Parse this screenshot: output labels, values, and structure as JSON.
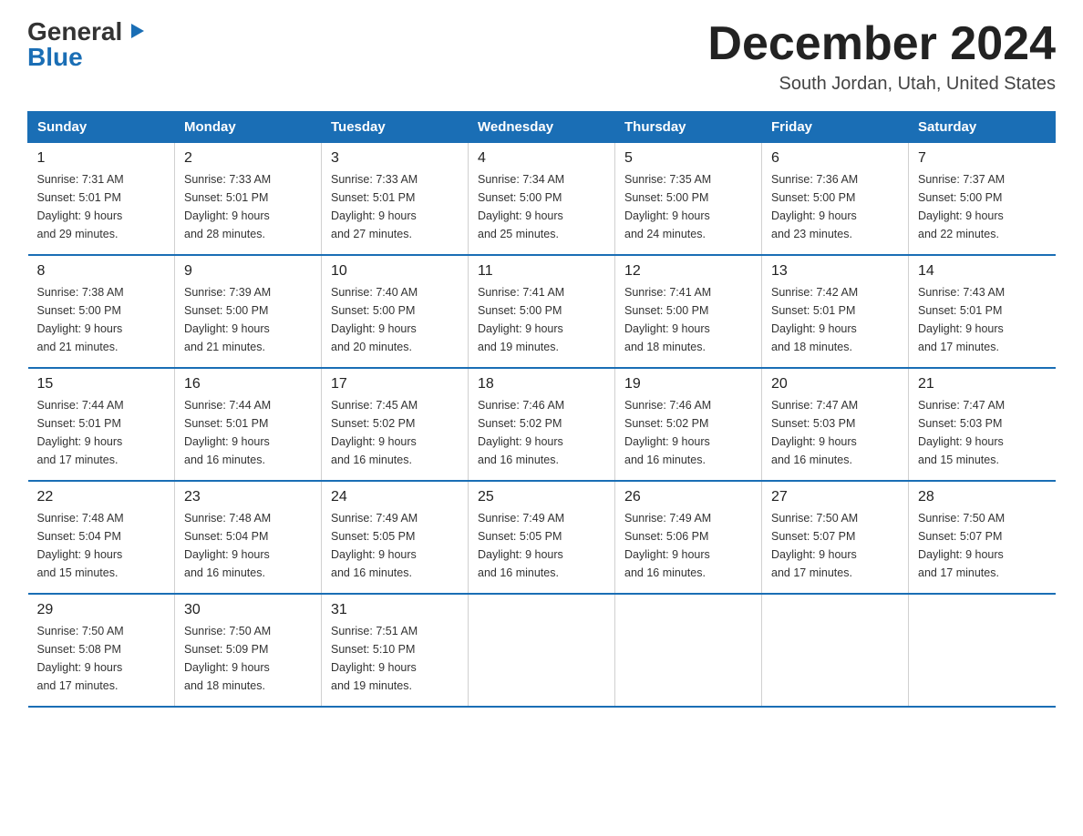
{
  "logo": {
    "general": "General",
    "blue": "Blue"
  },
  "title": "December 2024",
  "location": "South Jordan, Utah, United States",
  "days_of_week": [
    "Sunday",
    "Monday",
    "Tuesday",
    "Wednesday",
    "Thursday",
    "Friday",
    "Saturday"
  ],
  "weeks": [
    [
      {
        "day": "1",
        "sunrise": "7:31 AM",
        "sunset": "5:01 PM",
        "daylight": "9 hours and 29 minutes."
      },
      {
        "day": "2",
        "sunrise": "7:33 AM",
        "sunset": "5:01 PM",
        "daylight": "9 hours and 28 minutes."
      },
      {
        "day": "3",
        "sunrise": "7:33 AM",
        "sunset": "5:01 PM",
        "daylight": "9 hours and 27 minutes."
      },
      {
        "day": "4",
        "sunrise": "7:34 AM",
        "sunset": "5:00 PM",
        "daylight": "9 hours and 25 minutes."
      },
      {
        "day": "5",
        "sunrise": "7:35 AM",
        "sunset": "5:00 PM",
        "daylight": "9 hours and 24 minutes."
      },
      {
        "day": "6",
        "sunrise": "7:36 AM",
        "sunset": "5:00 PM",
        "daylight": "9 hours and 23 minutes."
      },
      {
        "day": "7",
        "sunrise": "7:37 AM",
        "sunset": "5:00 PM",
        "daylight": "9 hours and 22 minutes."
      }
    ],
    [
      {
        "day": "8",
        "sunrise": "7:38 AM",
        "sunset": "5:00 PM",
        "daylight": "9 hours and 21 minutes."
      },
      {
        "day": "9",
        "sunrise": "7:39 AM",
        "sunset": "5:00 PM",
        "daylight": "9 hours and 21 minutes."
      },
      {
        "day": "10",
        "sunrise": "7:40 AM",
        "sunset": "5:00 PM",
        "daylight": "9 hours and 20 minutes."
      },
      {
        "day": "11",
        "sunrise": "7:41 AM",
        "sunset": "5:00 PM",
        "daylight": "9 hours and 19 minutes."
      },
      {
        "day": "12",
        "sunrise": "7:41 AM",
        "sunset": "5:00 PM",
        "daylight": "9 hours and 18 minutes."
      },
      {
        "day": "13",
        "sunrise": "7:42 AM",
        "sunset": "5:01 PM",
        "daylight": "9 hours and 18 minutes."
      },
      {
        "day": "14",
        "sunrise": "7:43 AM",
        "sunset": "5:01 PM",
        "daylight": "9 hours and 17 minutes."
      }
    ],
    [
      {
        "day": "15",
        "sunrise": "7:44 AM",
        "sunset": "5:01 PM",
        "daylight": "9 hours and 17 minutes."
      },
      {
        "day": "16",
        "sunrise": "7:44 AM",
        "sunset": "5:01 PM",
        "daylight": "9 hours and 16 minutes."
      },
      {
        "day": "17",
        "sunrise": "7:45 AM",
        "sunset": "5:02 PM",
        "daylight": "9 hours and 16 minutes."
      },
      {
        "day": "18",
        "sunrise": "7:46 AM",
        "sunset": "5:02 PM",
        "daylight": "9 hours and 16 minutes."
      },
      {
        "day": "19",
        "sunrise": "7:46 AM",
        "sunset": "5:02 PM",
        "daylight": "9 hours and 16 minutes."
      },
      {
        "day": "20",
        "sunrise": "7:47 AM",
        "sunset": "5:03 PM",
        "daylight": "9 hours and 16 minutes."
      },
      {
        "day": "21",
        "sunrise": "7:47 AM",
        "sunset": "5:03 PM",
        "daylight": "9 hours and 15 minutes."
      }
    ],
    [
      {
        "day": "22",
        "sunrise": "7:48 AM",
        "sunset": "5:04 PM",
        "daylight": "9 hours and 15 minutes."
      },
      {
        "day": "23",
        "sunrise": "7:48 AM",
        "sunset": "5:04 PM",
        "daylight": "9 hours and 16 minutes."
      },
      {
        "day": "24",
        "sunrise": "7:49 AM",
        "sunset": "5:05 PM",
        "daylight": "9 hours and 16 minutes."
      },
      {
        "day": "25",
        "sunrise": "7:49 AM",
        "sunset": "5:05 PM",
        "daylight": "9 hours and 16 minutes."
      },
      {
        "day": "26",
        "sunrise": "7:49 AM",
        "sunset": "5:06 PM",
        "daylight": "9 hours and 16 minutes."
      },
      {
        "day": "27",
        "sunrise": "7:50 AM",
        "sunset": "5:07 PM",
        "daylight": "9 hours and 17 minutes."
      },
      {
        "day": "28",
        "sunrise": "7:50 AM",
        "sunset": "5:07 PM",
        "daylight": "9 hours and 17 minutes."
      }
    ],
    [
      {
        "day": "29",
        "sunrise": "7:50 AM",
        "sunset": "5:08 PM",
        "daylight": "9 hours and 17 minutes."
      },
      {
        "day": "30",
        "sunrise": "7:50 AM",
        "sunset": "5:09 PM",
        "daylight": "9 hours and 18 minutes."
      },
      {
        "day": "31",
        "sunrise": "7:51 AM",
        "sunset": "5:10 PM",
        "daylight": "9 hours and 19 minutes."
      },
      null,
      null,
      null,
      null
    ]
  ],
  "labels": {
    "sunrise": "Sunrise:",
    "sunset": "Sunset:",
    "daylight": "Daylight:"
  }
}
